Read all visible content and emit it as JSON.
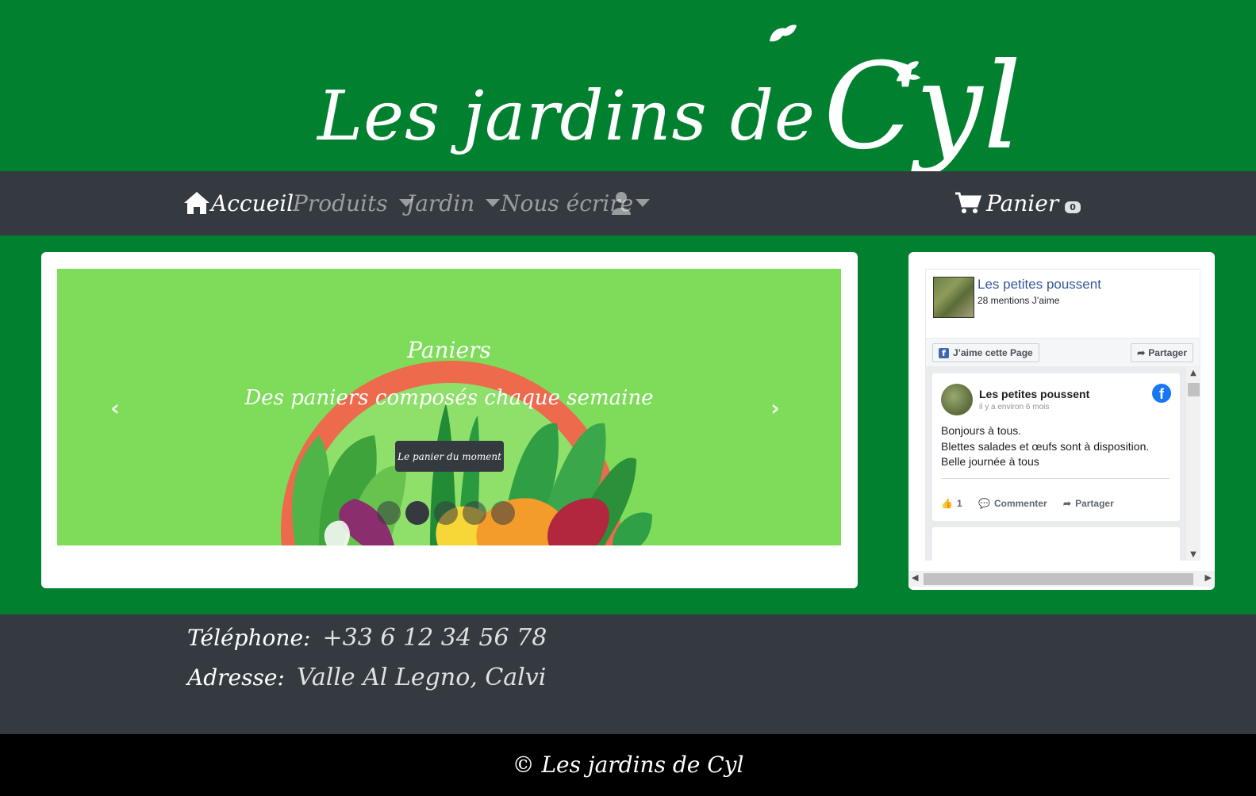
{
  "brand": {
    "name_part": "Les jardins de",
    "name_big": "Cyl"
  },
  "nav": {
    "home_label": "Accueil",
    "products_label": "Produits",
    "garden_label": "Jardin",
    "contact_label": "Nous écrire",
    "cart_label": "Panier",
    "cart_count": "0"
  },
  "carousel": {
    "title": "Paniers",
    "subtitle": "Des paniers composés chaque semaine",
    "button": "Le panier du moment",
    "slides_count": 5,
    "active_index": 1
  },
  "facebook": {
    "page_name": "Les petites poussent",
    "likes": "28 mentions J’aime",
    "like_button": "J’aime cette Page",
    "share_button": "Partager",
    "post": {
      "author": "Les petites poussent",
      "time": "il y a environ 6 mois",
      "lines": [
        "Bonjours à tous.",
        "Blettes salades et œufs sont à disposition.",
        "Belle journée à tous"
      ],
      "like_count": "1",
      "comment_label": "Commenter",
      "share_label": "Partager"
    }
  },
  "contact": {
    "phone_label": "Téléphone:",
    "phone_value": "+33 6 12 34 56 78",
    "address_label": "Adresse:",
    "address_value": "Valle Al Legno, Calvi"
  },
  "footer": {
    "copyright": "© Les jardins de Cyl"
  },
  "colors": {
    "brand_green": "#01802f",
    "dark": "#343a40",
    "slide_green": "#7edc5a",
    "fb_blue": "#365899"
  }
}
